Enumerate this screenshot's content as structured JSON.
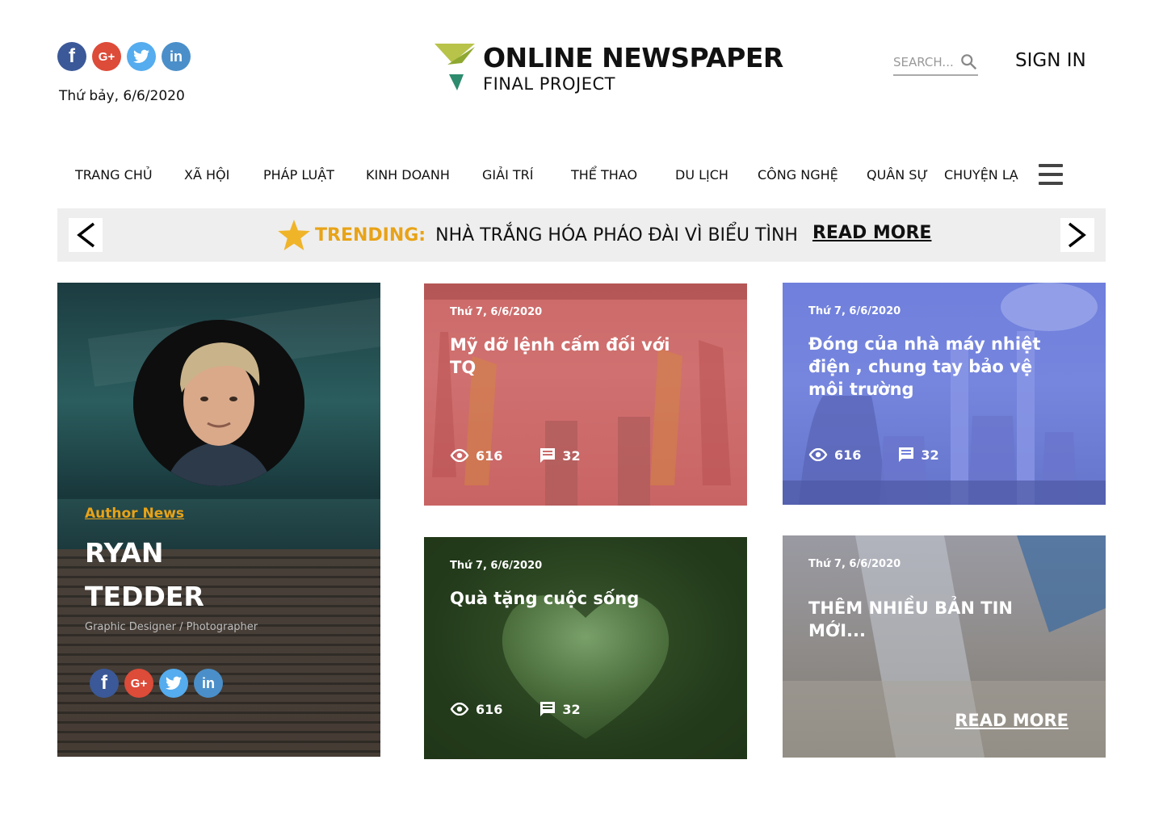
{
  "header": {
    "date": "Thứ bảy, 6/6/2020",
    "logo_title": "ONLINE NEWSPAPER",
    "logo_subtitle": "FINAL PROJECT",
    "search_placeholder": "SEARCH...",
    "sign_in": "SIGN IN",
    "social": [
      "facebook-icon",
      "google-plus-icon",
      "twitter-icon",
      "linkedin-icon"
    ],
    "social_labels": {
      "google_plus": "G+",
      "linkedin": "in"
    }
  },
  "nav": {
    "items": [
      "TRANG CHỦ",
      "XÃ HỘI",
      "PHÁP LUẬT",
      "KINH DOANH",
      "GIẢI TRÍ",
      "THỂ THAO",
      "DU LỊCH",
      "CÔNG NGHỆ",
      "QUÂN SỰ",
      "CHUYỆN LẠ"
    ]
  },
  "trending": {
    "label": "TRENDING:",
    "headline": "NHÀ TRẮNG HÓA PHÁO ĐÀI VÌ BIỂU TÌNH",
    "read_more": "READ MORE"
  },
  "author": {
    "label": "Author News",
    "first_name": "RYAN",
    "last_name": "TEDDER",
    "role": "Graphic Designer / Photographer"
  },
  "cards": [
    {
      "date": "Thứ 7, 6/6/2020",
      "title": "Mỹ dỡ lệnh cấm đối với TQ",
      "views": "616",
      "comments": "32"
    },
    {
      "date": "Thứ 7, 6/6/2020",
      "title": "Đóng của nhà máy nhiệt điện , chung tay bảo vệ môi trường",
      "views": "616",
      "comments": "32"
    },
    {
      "date": "Thứ 7, 6/6/2020",
      "title": "Quà tặng cuộc sống",
      "views": "616",
      "comments": "32"
    },
    {
      "date": "Thứ 7, 6/6/2020",
      "title": "THÊM NHIỀU BẢN TIN MỚI...",
      "read_more": "READ MORE"
    }
  ],
  "colors": {
    "accent": "#e8a317",
    "trend_bg": "#eeeeee",
    "card_red": "#cc6a69",
    "card_blue": "#6f7fdc"
  }
}
